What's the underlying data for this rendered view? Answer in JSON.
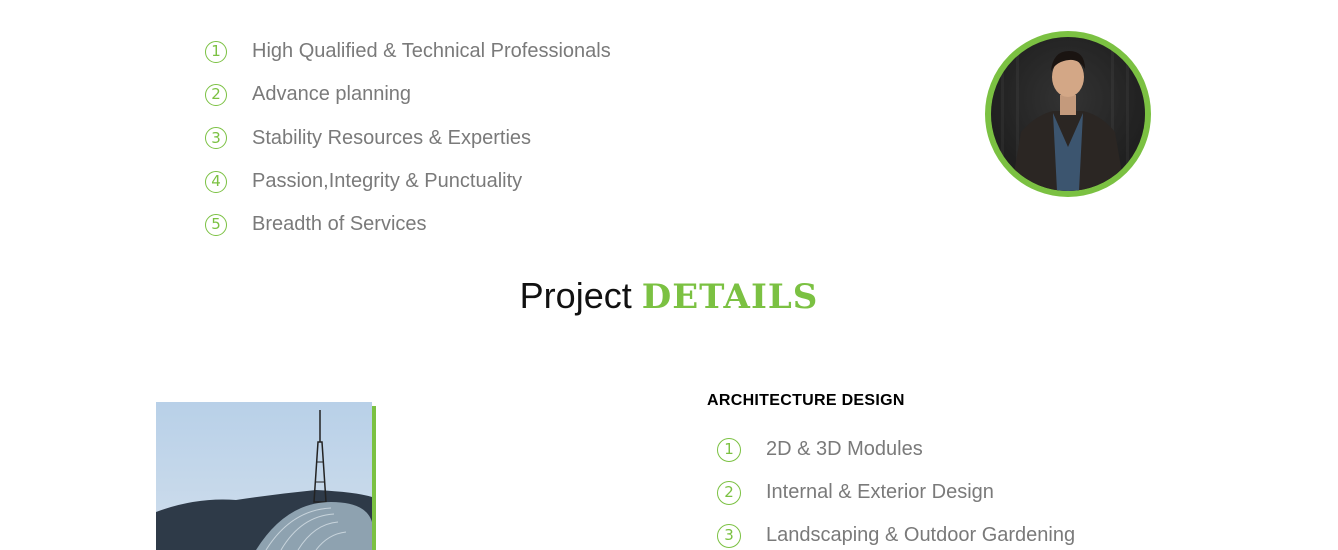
{
  "features": [
    {
      "num": "1",
      "text": "High Qualified & Technical Professionals"
    },
    {
      "num": "2",
      "text": "Advance planning"
    },
    {
      "num": "3",
      "text": "Stability Resources & Experties"
    },
    {
      "num": "4",
      "text": "Passion,Integrity & Punctuality"
    },
    {
      "num": "5",
      "text": "Breadth of Services"
    }
  ],
  "section": {
    "title_plain": "Project ",
    "title_accent": "DETAILS"
  },
  "architecture": {
    "heading": "ARCHITECTURE DESIGN",
    "items": [
      {
        "num": "1",
        "text": "2D & 3D Modules"
      },
      {
        "num": "2",
        "text": "Internal & Exterior Design"
      },
      {
        "num": "3",
        "text": "Landscaping & Outdoor Gardening"
      }
    ]
  },
  "colors": {
    "accent": "#7bc142",
    "text_muted": "#7a7a7a"
  },
  "icons": {
    "number_circle": "circled-number-icon",
    "avatar": "person-photo",
    "project_photo": "tower-dome-photo"
  }
}
